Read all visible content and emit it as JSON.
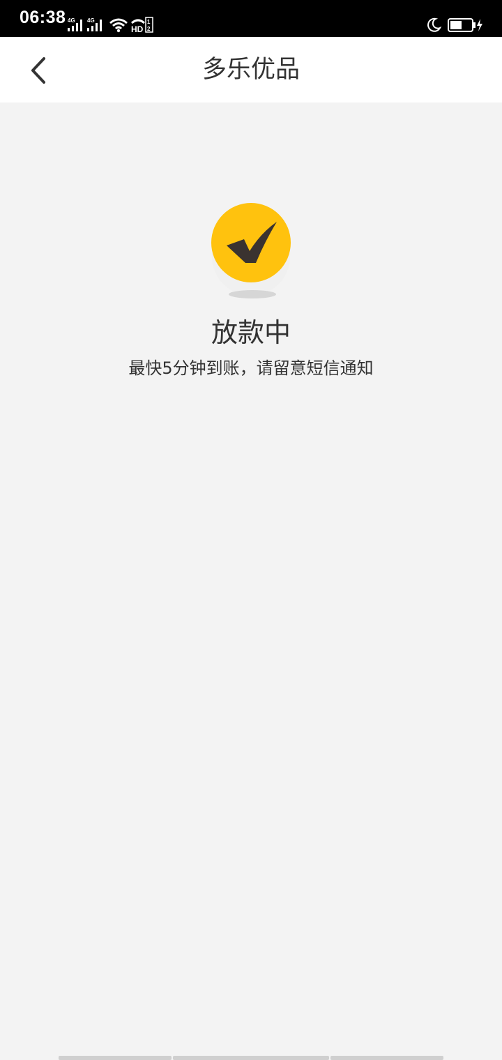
{
  "status_bar": {
    "time": "06:38",
    "network_1": "4G",
    "network_2": "4G",
    "hd_label": "HD",
    "icons": [
      "signal-4g-icon",
      "signal-4g-icon",
      "wifi-icon",
      "hd-call-icon",
      "moon-icon",
      "battery-charging-icon"
    ]
  },
  "nav": {
    "back_icon": "chevron-left-icon",
    "title": "多乐优品"
  },
  "main": {
    "icon": "check-circle-icon",
    "status_title": "放款中",
    "status_desc": "最快5分钟到账，请留意短信通知"
  },
  "colors": {
    "accent": "#FFC20E",
    "check": "#3a3330",
    "background": "#f3f3f3",
    "header": "#ffffff",
    "text": "#333333"
  }
}
